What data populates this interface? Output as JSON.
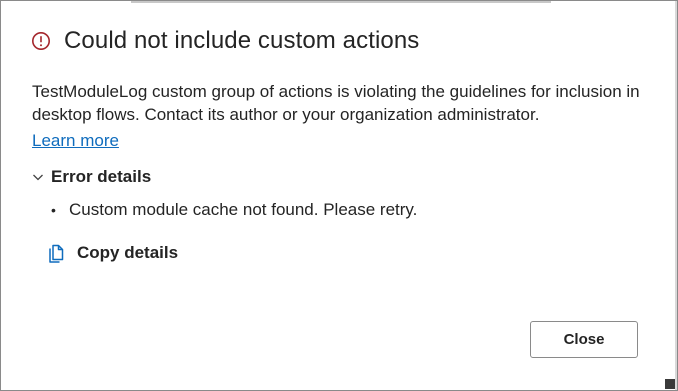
{
  "dialog": {
    "title": "Could not include custom actions",
    "message": "TestModuleLog custom group of actions is violating the guidelines for inclusion in desktop flows. Contact its author or your organization administrator.",
    "learn_more_label": "Learn more",
    "error_details": {
      "toggle_label": "Error details",
      "expanded": true,
      "items": [
        "Custom module cache not found. Please retry."
      ]
    },
    "copy_details_label": "Copy details",
    "close_label": "Close"
  },
  "icons": {
    "title_icon": "error-circle-icon",
    "toggle_icon": "chevron-down-icon",
    "copy_icon": "copy-icon"
  },
  "colors": {
    "error": "#a4262c",
    "link": "#0f6cbd",
    "text": "#242424",
    "accent_icon": "#0f6cbd"
  }
}
